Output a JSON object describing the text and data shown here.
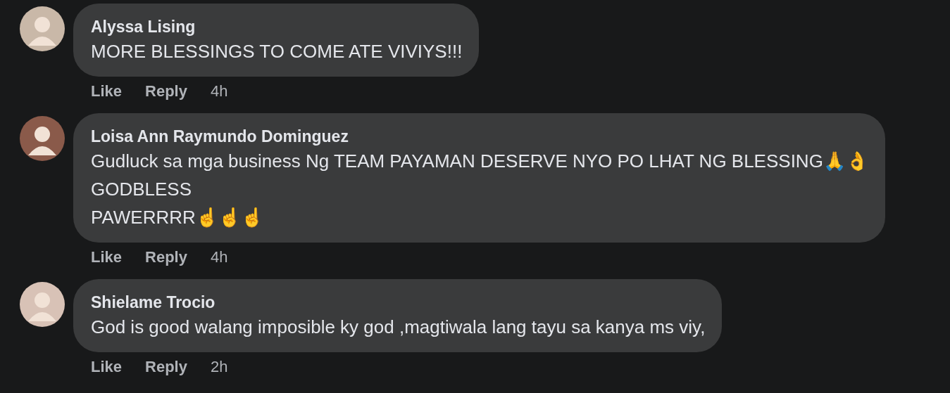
{
  "comments": [
    {
      "author": "Alyssa Lising",
      "text": "MORE BLESSINGS TO COME ATE VIVIYS!!!",
      "actions": [
        "Like",
        "Reply"
      ],
      "time": "4h"
    },
    {
      "author": "Loisa Ann Raymundo Dominguez",
      "text": "Gudluck sa mga business Ng TEAM PAYAMAN DESERVE NYO PO LHAT NG BLESSING🙏👌\nGODBLESS\nPAWERRRR☝☝☝",
      "actions": [
        "Like",
        "Reply"
      ],
      "time": "4h"
    },
    {
      "author": "Shielame Trocio",
      "text": "God is good walang imposible ky god ,magtiwala lang tayu sa kanya ms viy,",
      "actions": [
        "Like",
        "Reply"
      ],
      "time": "2h"
    }
  ]
}
